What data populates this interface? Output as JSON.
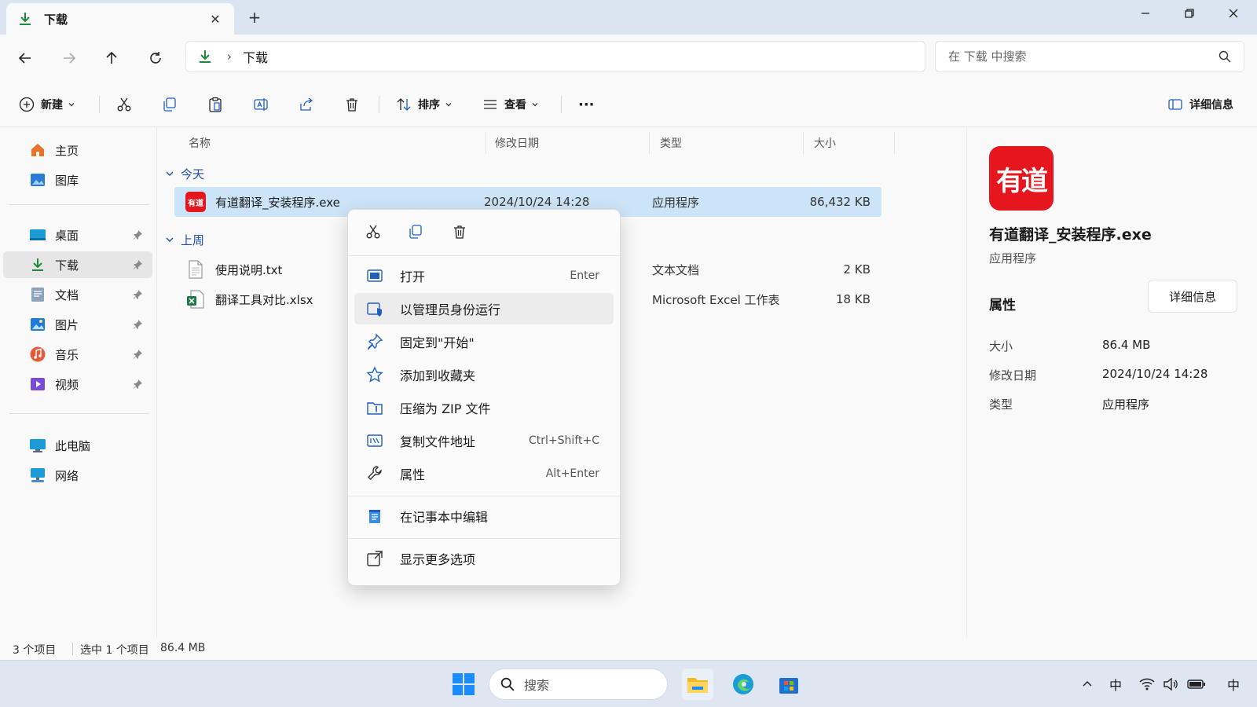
{
  "tab": {
    "title": "下载",
    "new_tab": "+"
  },
  "address": {
    "crumb": "下载",
    "search_placeholder": "在 下载 中搜索"
  },
  "commands": {
    "new": "新建",
    "sort": "排序",
    "view": "查看",
    "more": "···",
    "details": "详细信息"
  },
  "sidebar": {
    "top": [
      {
        "label": "主页",
        "icon": "home-icon"
      },
      {
        "label": "图库",
        "icon": "gallery-icon"
      }
    ],
    "pinned": [
      {
        "label": "桌面",
        "icon": "desktop-icon"
      },
      {
        "label": "下载",
        "icon": "download-icon"
      },
      {
        "label": "文档",
        "icon": "documents-icon"
      },
      {
        "label": "图片",
        "icon": "pictures-icon"
      },
      {
        "label": "音乐",
        "icon": "music-icon"
      },
      {
        "label": "视频",
        "icon": "videos-icon"
      }
    ],
    "bottom": [
      {
        "label": "此电脑",
        "icon": "this-pc-icon"
      },
      {
        "label": "网络",
        "icon": "network-icon"
      }
    ]
  },
  "columns": {
    "name": "名称",
    "date": "修改日期",
    "type": "类型",
    "size": "大小"
  },
  "groups": {
    "today": "今天",
    "last_week": "上周"
  },
  "files": [
    {
      "name": "有道翻译_安装程序.exe",
      "date": "2024/10/24 14:28",
      "type": "应用程序",
      "size": "86,432 KB",
      "icon": "youdao-app-icon"
    },
    {
      "name": "使用说明.txt",
      "date": "",
      "type": "文本文档",
      "size": "2 KB",
      "icon": "text-file-icon"
    },
    {
      "name": "翻译工具对比.xlsx",
      "date": "",
      "type": "Microsoft Excel 工作表",
      "size": "18 KB",
      "icon": "excel-file-icon"
    }
  ],
  "details_pane": {
    "logo_text": "有道",
    "name": "有道翻译_安装程序.exe",
    "type": "应用程序",
    "props_title": "属性",
    "button": "详细信息",
    "props": [
      {
        "k": "大小",
        "v": "86.4 MB"
      },
      {
        "k": "修改日期",
        "v": "2024/10/24 14:28"
      },
      {
        "k": "类型",
        "v": "应用程序"
      }
    ]
  },
  "status": {
    "count": "3 个项目",
    "selected": "选中 1 个项目",
    "size": "86.4 MB"
  },
  "context_menu": {
    "items": [
      {
        "label": "打开",
        "shortcut": "Enter",
        "icon": "open-icon"
      },
      {
        "label": "以管理员身份运行",
        "shortcut": "",
        "icon": "run-as-admin-icon"
      },
      {
        "label": "固定到\"开始\"",
        "shortcut": "",
        "icon": "pin-icon"
      },
      {
        "label": "添加到收藏夹",
        "shortcut": "",
        "icon": "star-icon"
      },
      {
        "label": "压缩为 ZIP 文件",
        "shortcut": "",
        "icon": "zip-icon"
      },
      {
        "label": "复制文件地址",
        "shortcut": "Ctrl+Shift+C",
        "icon": "copy-path-icon"
      },
      {
        "label": "属性",
        "shortcut": "Alt+Enter",
        "icon": "wrench-icon"
      },
      {
        "label": "在记事本中编辑",
        "shortcut": "",
        "icon": "notepad-icon"
      },
      {
        "label": "显示更多选项",
        "shortcut": "",
        "icon": "more-options-icon"
      }
    ]
  },
  "taskbar": {
    "search": "搜索",
    "ime": "中",
    "ime2": "中"
  },
  "colors": {
    "accent": "#0067c0",
    "selection": "#cce4f7",
    "youdao_red": "#e5161e",
    "titlebar": "#dbe5f1"
  }
}
